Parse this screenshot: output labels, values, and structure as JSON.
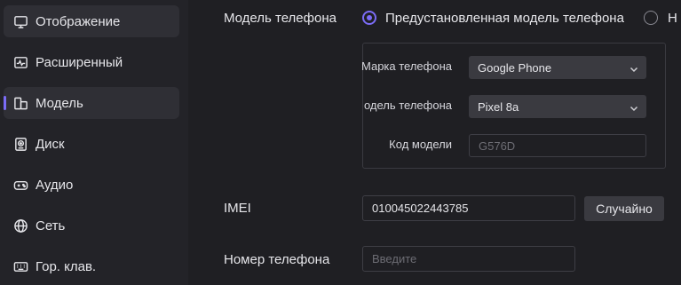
{
  "sidebar": {
    "items": [
      {
        "label": "Отображение",
        "icon": "monitor-icon"
      },
      {
        "label": "Расширенный",
        "icon": "activity-icon"
      },
      {
        "label": "Модель",
        "icon": "model-icon"
      },
      {
        "label": "Диск",
        "icon": "disk-icon"
      },
      {
        "label": "Аудио",
        "icon": "gamepad-icon"
      },
      {
        "label": "Сеть",
        "icon": "globe-icon"
      },
      {
        "label": "Гор. клав.",
        "icon": "keyboard-icon"
      }
    ],
    "active_index": 2
  },
  "model_section": {
    "label": "Модель телефона",
    "radio_preset_label": "Предустановленная модель телефона",
    "radio_other_label": "Н",
    "brand_label": "Марка телефона",
    "brand_value": "Google Phone",
    "model_label": "одель телефона",
    "model_value": "Pixel 8a",
    "code_label": "Код модели",
    "code_value": "G576D"
  },
  "imei": {
    "label": "IMEI",
    "value": "010045022443785",
    "random_button": "Случайно"
  },
  "phone": {
    "label": "Номер телефона",
    "placeholder": "Введите"
  },
  "colors": {
    "accent": "#7b6cf6",
    "background": "#1f1f23",
    "sidebar": "#232328"
  }
}
